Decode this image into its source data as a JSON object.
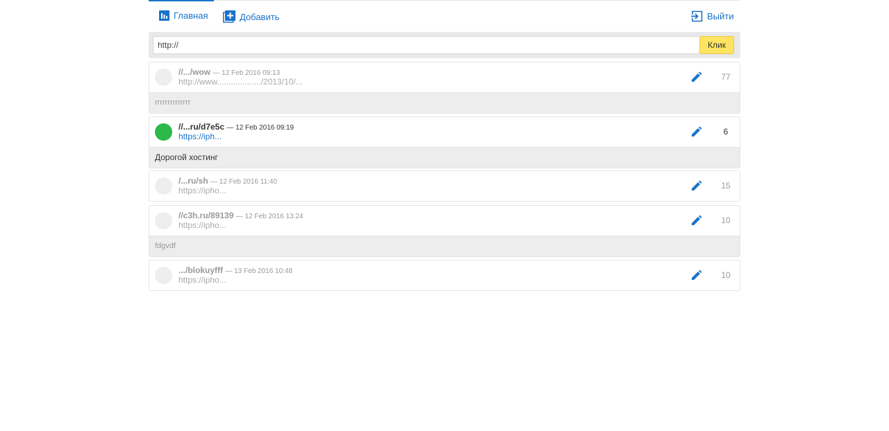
{
  "nav": {
    "home_label": "Главная",
    "add_label": "Добавить",
    "logout_label": "Выйти"
  },
  "search": {
    "value": "http://",
    "button_label": "Клик"
  },
  "links": [
    {
      "title": "//.../wow",
      "date": "— 12 Feb 2016 09:13",
      "url": "http://www.................../2013/10/...",
      "count": "77",
      "note": "rrrrrrrrrrrrrr",
      "active": false
    },
    {
      "title": "//...ru/d7e5c",
      "date": "— 12 Feb 2016 09:19",
      "url": "https://iph...",
      "count": "6",
      "note": "Дорогой хостинг",
      "active": true
    },
    {
      "title": "/...ru/sh",
      "date": "— 12 Feb 2016 11:40",
      "url": "https://ipho...",
      "count": "15",
      "note": "",
      "active": false
    },
    {
      "title": "//c3h.ru/89139",
      "date": "— 12 Feb 2016 13:24",
      "url": "https://ipho...",
      "count": "10",
      "note": "fdgvdf",
      "active": false
    },
    {
      "title": ".../blokuyfff",
      "date": "— 13 Feb 2016 10:48",
      "url": "https://ipho...",
      "count": "10",
      "note": "",
      "active": false
    }
  ],
  "colors": {
    "accent": "#1a73c9",
    "button": "#ffe461",
    "active_dot": "#2db84a"
  }
}
